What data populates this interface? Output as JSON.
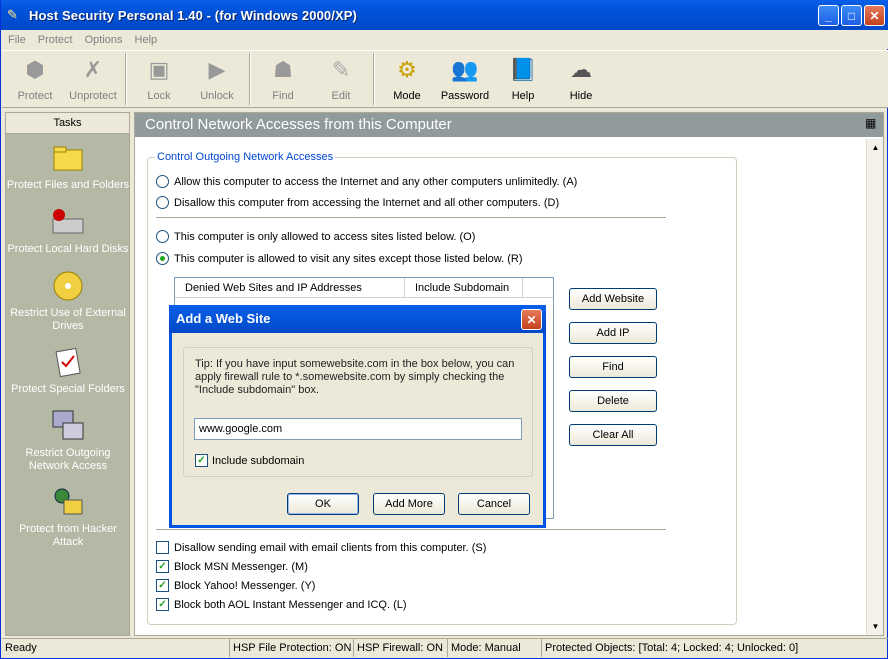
{
  "app": {
    "title": "Host Security Personal 1.40 - (for Windows 2000/XP)"
  },
  "menu": [
    "File",
    "Protect",
    "Options",
    "Help"
  ],
  "toolbar": {
    "items": [
      {
        "label": "Protect",
        "icon": "protect-icon",
        "enabled": false
      },
      {
        "label": "Unprotect",
        "icon": "unprotect-icon",
        "enabled": false
      },
      {
        "label": "Lock",
        "icon": "lock-icon",
        "enabled": false
      },
      {
        "label": "Unlock",
        "icon": "unlock-icon",
        "enabled": false
      },
      {
        "label": "Find",
        "icon": "find-icon",
        "enabled": false
      },
      {
        "label": "Edit",
        "icon": "edit-icon",
        "enabled": false
      },
      {
        "label": "Mode",
        "icon": "mode-icon",
        "enabled": true
      },
      {
        "label": "Password",
        "icon": "password-icon",
        "enabled": true
      },
      {
        "label": "Help",
        "icon": "help-book-icon",
        "enabled": true
      },
      {
        "label": "Hide",
        "icon": "hide-cloud-icon",
        "enabled": true
      }
    ]
  },
  "tasks": {
    "header": "Tasks",
    "items": [
      {
        "label": "Protect Files and Folders",
        "icon": "folder-icon"
      },
      {
        "label": "Protect Local Hard Disks",
        "icon": "hard-disk-icon"
      },
      {
        "label": "Restrict Use of External Drives",
        "icon": "cd-drive-icon"
      },
      {
        "label": "Protect Special Folders",
        "icon": "special-folder-icon"
      },
      {
        "label": "Restrict Outgoing Network Access",
        "icon": "network-icon"
      },
      {
        "label": "Protect from Hacker Attack",
        "icon": "hacker-shield-icon"
      }
    ]
  },
  "content": {
    "title": "Control Network Accesses from this Computer",
    "group_label": "Control Outgoing Network Accesses",
    "radios": [
      {
        "label": "Allow this computer to access the Internet and any other computers unlimitedly. (A)",
        "selected": false
      },
      {
        "label": "Disallow this computer from accessing the Internet and all other computers. (D)",
        "selected": false
      },
      {
        "label": "This computer is only allowed to access sites listed below. (O)",
        "selected": false
      },
      {
        "label": "This computer is allowed to visit any sites except those listed below. (R)",
        "selected": true
      }
    ],
    "list_headers": [
      "Denied Web Sites and IP Addresses",
      "Include Subdomain"
    ],
    "side_buttons": [
      "Add Website",
      "Add IP",
      "Find",
      "Delete",
      "Clear All"
    ],
    "checks": [
      {
        "label": "Disallow sending email with email clients from this computer. (S)",
        "checked": false
      },
      {
        "label": "Block MSN Messenger. (M)",
        "checked": true
      },
      {
        "label": "Block Yahoo! Messenger. (Y)",
        "checked": true
      },
      {
        "label": "Block both AOL Instant Messenger and ICQ. (L)",
        "checked": true
      }
    ]
  },
  "dialog": {
    "title": "Add a Web Site",
    "tip": "Tip: If you have input somewebsite.com in the box below, you can apply firewall rule to *.somewebsite.com by simply checking the \"Include subdomain\" box.",
    "input_value": "www.google.com",
    "include_subdomain_label": "Include subdomain",
    "include_subdomain_checked": true,
    "buttons": [
      "OK",
      "Add More",
      "Cancel"
    ]
  },
  "status": [
    "Ready",
    "HSP File Protection: ON",
    "HSP Firewall: ON",
    "Mode: Manual",
    "Protected Objects: [Total: 4; Locked: 4; Unlocked: 0]"
  ]
}
